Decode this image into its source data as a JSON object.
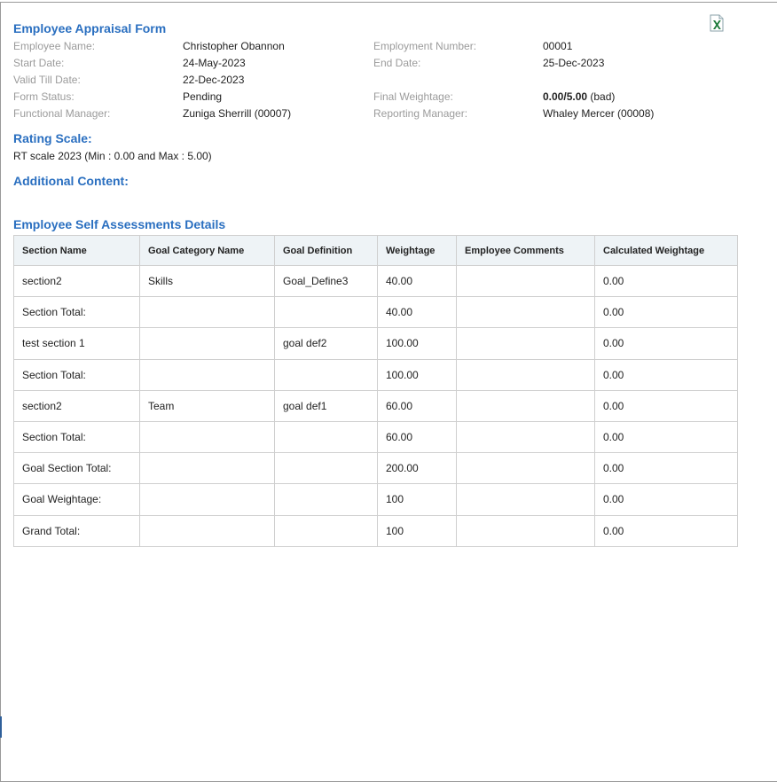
{
  "form": {
    "title": "Employee Appraisal Form",
    "info": [
      {
        "label1": "Employee Name:",
        "value1": "Christopher Obannon",
        "label2": "Employment Number:",
        "value2": "00001"
      },
      {
        "label1": "Start Date:",
        "value1": "24-May-2023",
        "label2": "End Date:",
        "value2": "25-Dec-2023"
      },
      {
        "label1": "Valid Till Date:",
        "value1": "22-Dec-2023",
        "label2": "",
        "value2": ""
      },
      {
        "label1": "Form Status:",
        "value1": "Pending",
        "label2": "Final Weightage:",
        "value2": ""
      },
      {
        "label1": "Functional Manager:",
        "value1": "Zuniga Sherrill (00007)",
        "label2": "Reporting Manager:",
        "value2": "Whaley Mercer (00008)"
      }
    ],
    "final_weightage": {
      "score": "0.00/5.00",
      "rating": "(bad)"
    }
  },
  "rating_scale": {
    "heading": "Rating Scale:",
    "text": "RT scale 2023 (Min : 0.00 and Max : 5.00)"
  },
  "additional_content": {
    "heading": "Additional Content:"
  },
  "self_assessment": {
    "heading": "Employee Self Assessments Details",
    "columns": [
      "Section Name",
      "Goal Category Name",
      "Goal Definition",
      "Weightage",
      "Employee Comments",
      "Calculated Weightage"
    ],
    "rows": [
      [
        "section2",
        "Skills",
        "Goal_Define3",
        "40.00",
        "",
        "0.00"
      ],
      [
        "Section Total:",
        "",
        "",
        "40.00",
        "",
        "0.00"
      ],
      [
        "test section 1",
        "",
        "goal def2",
        "100.00",
        "",
        "0.00"
      ],
      [
        "Section Total:",
        "",
        "",
        "100.00",
        "",
        "0.00"
      ],
      [
        "section2",
        "Team",
        "goal def1",
        "60.00",
        "",
        "0.00"
      ],
      [
        "Section Total:",
        "",
        "",
        "60.00",
        "",
        "0.00"
      ],
      [
        "Goal Section Total:",
        "",
        "",
        "200.00",
        "",
        "0.00"
      ],
      [
        "Goal Weightage:",
        "",
        "",
        "100",
        "",
        "0.00"
      ],
      [
        "Grand Total:",
        "",
        "",
        "100",
        "",
        "0.00"
      ]
    ]
  },
  "icons": {
    "export": "excel-export-icon"
  },
  "colors": {
    "heading": "#2a6fc0",
    "label": "#9b9b9b",
    "table_header_bg": "#eef3f6",
    "excel_green": "#1d7a3a"
  }
}
